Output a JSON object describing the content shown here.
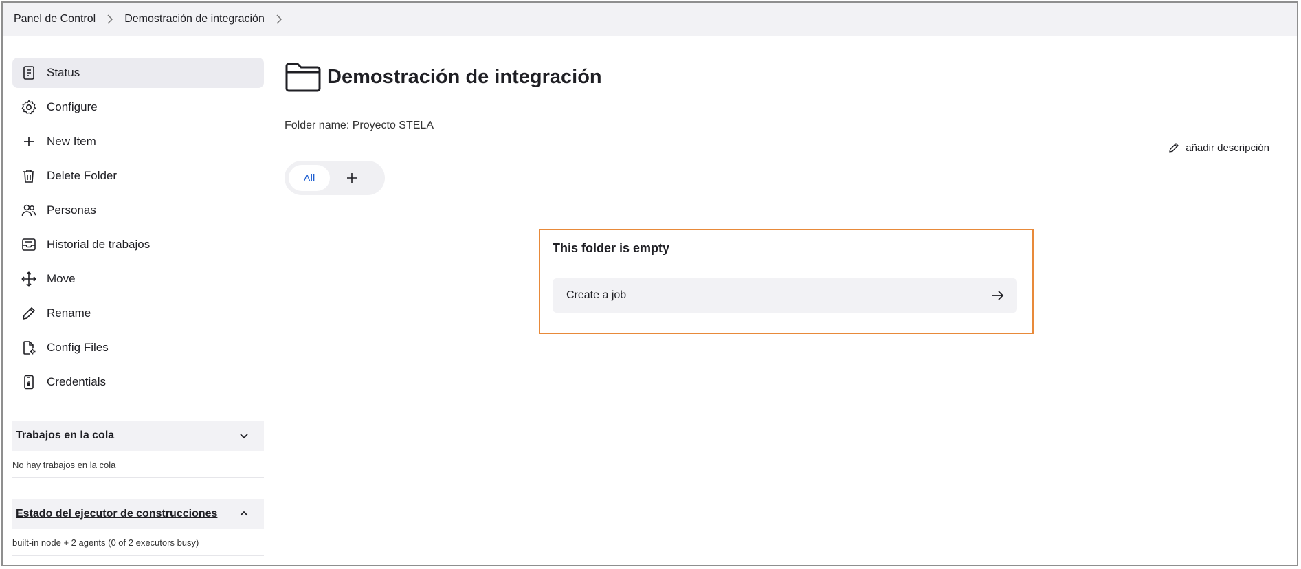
{
  "breadcrumb": {
    "items": [
      "Panel de Control",
      "Demostración de integración"
    ]
  },
  "sidebar": {
    "items": [
      {
        "label": "Status",
        "icon": "document-icon",
        "active": true
      },
      {
        "label": "Configure",
        "icon": "gear-icon"
      },
      {
        "label": "New Item",
        "icon": "plus-icon"
      },
      {
        "label": "Delete Folder",
        "icon": "trash-icon"
      },
      {
        "label": "Personas",
        "icon": "people-icon"
      },
      {
        "label": "Historial de trabajos",
        "icon": "inbox-icon"
      },
      {
        "label": "Move",
        "icon": "move-icon"
      },
      {
        "label": "Rename",
        "icon": "pencil-icon"
      },
      {
        "label": "Config Files",
        "icon": "file-gear-icon"
      },
      {
        "label": "Credentials",
        "icon": "phone-lock-icon"
      }
    ]
  },
  "queue": {
    "title": "Trabajos en la cola",
    "body": "No hay trabajos en la cola"
  },
  "executors": {
    "title": "Estado del ejecutor de construcciones",
    "body": "built-in node + 2 agents (0 of 2 executors busy)"
  },
  "main": {
    "title": "Demostración de integración",
    "folder_name": "Folder name: Proyecto STELA",
    "add_description": "añadir descripción",
    "tabs": {
      "all": "All"
    },
    "empty": {
      "title": "This folder is empty",
      "action": "Create a job"
    }
  },
  "colors": {
    "accent": "#1f5fd1",
    "highlight_border": "#e88a3a",
    "panel_bg": "#f2f2f5"
  }
}
